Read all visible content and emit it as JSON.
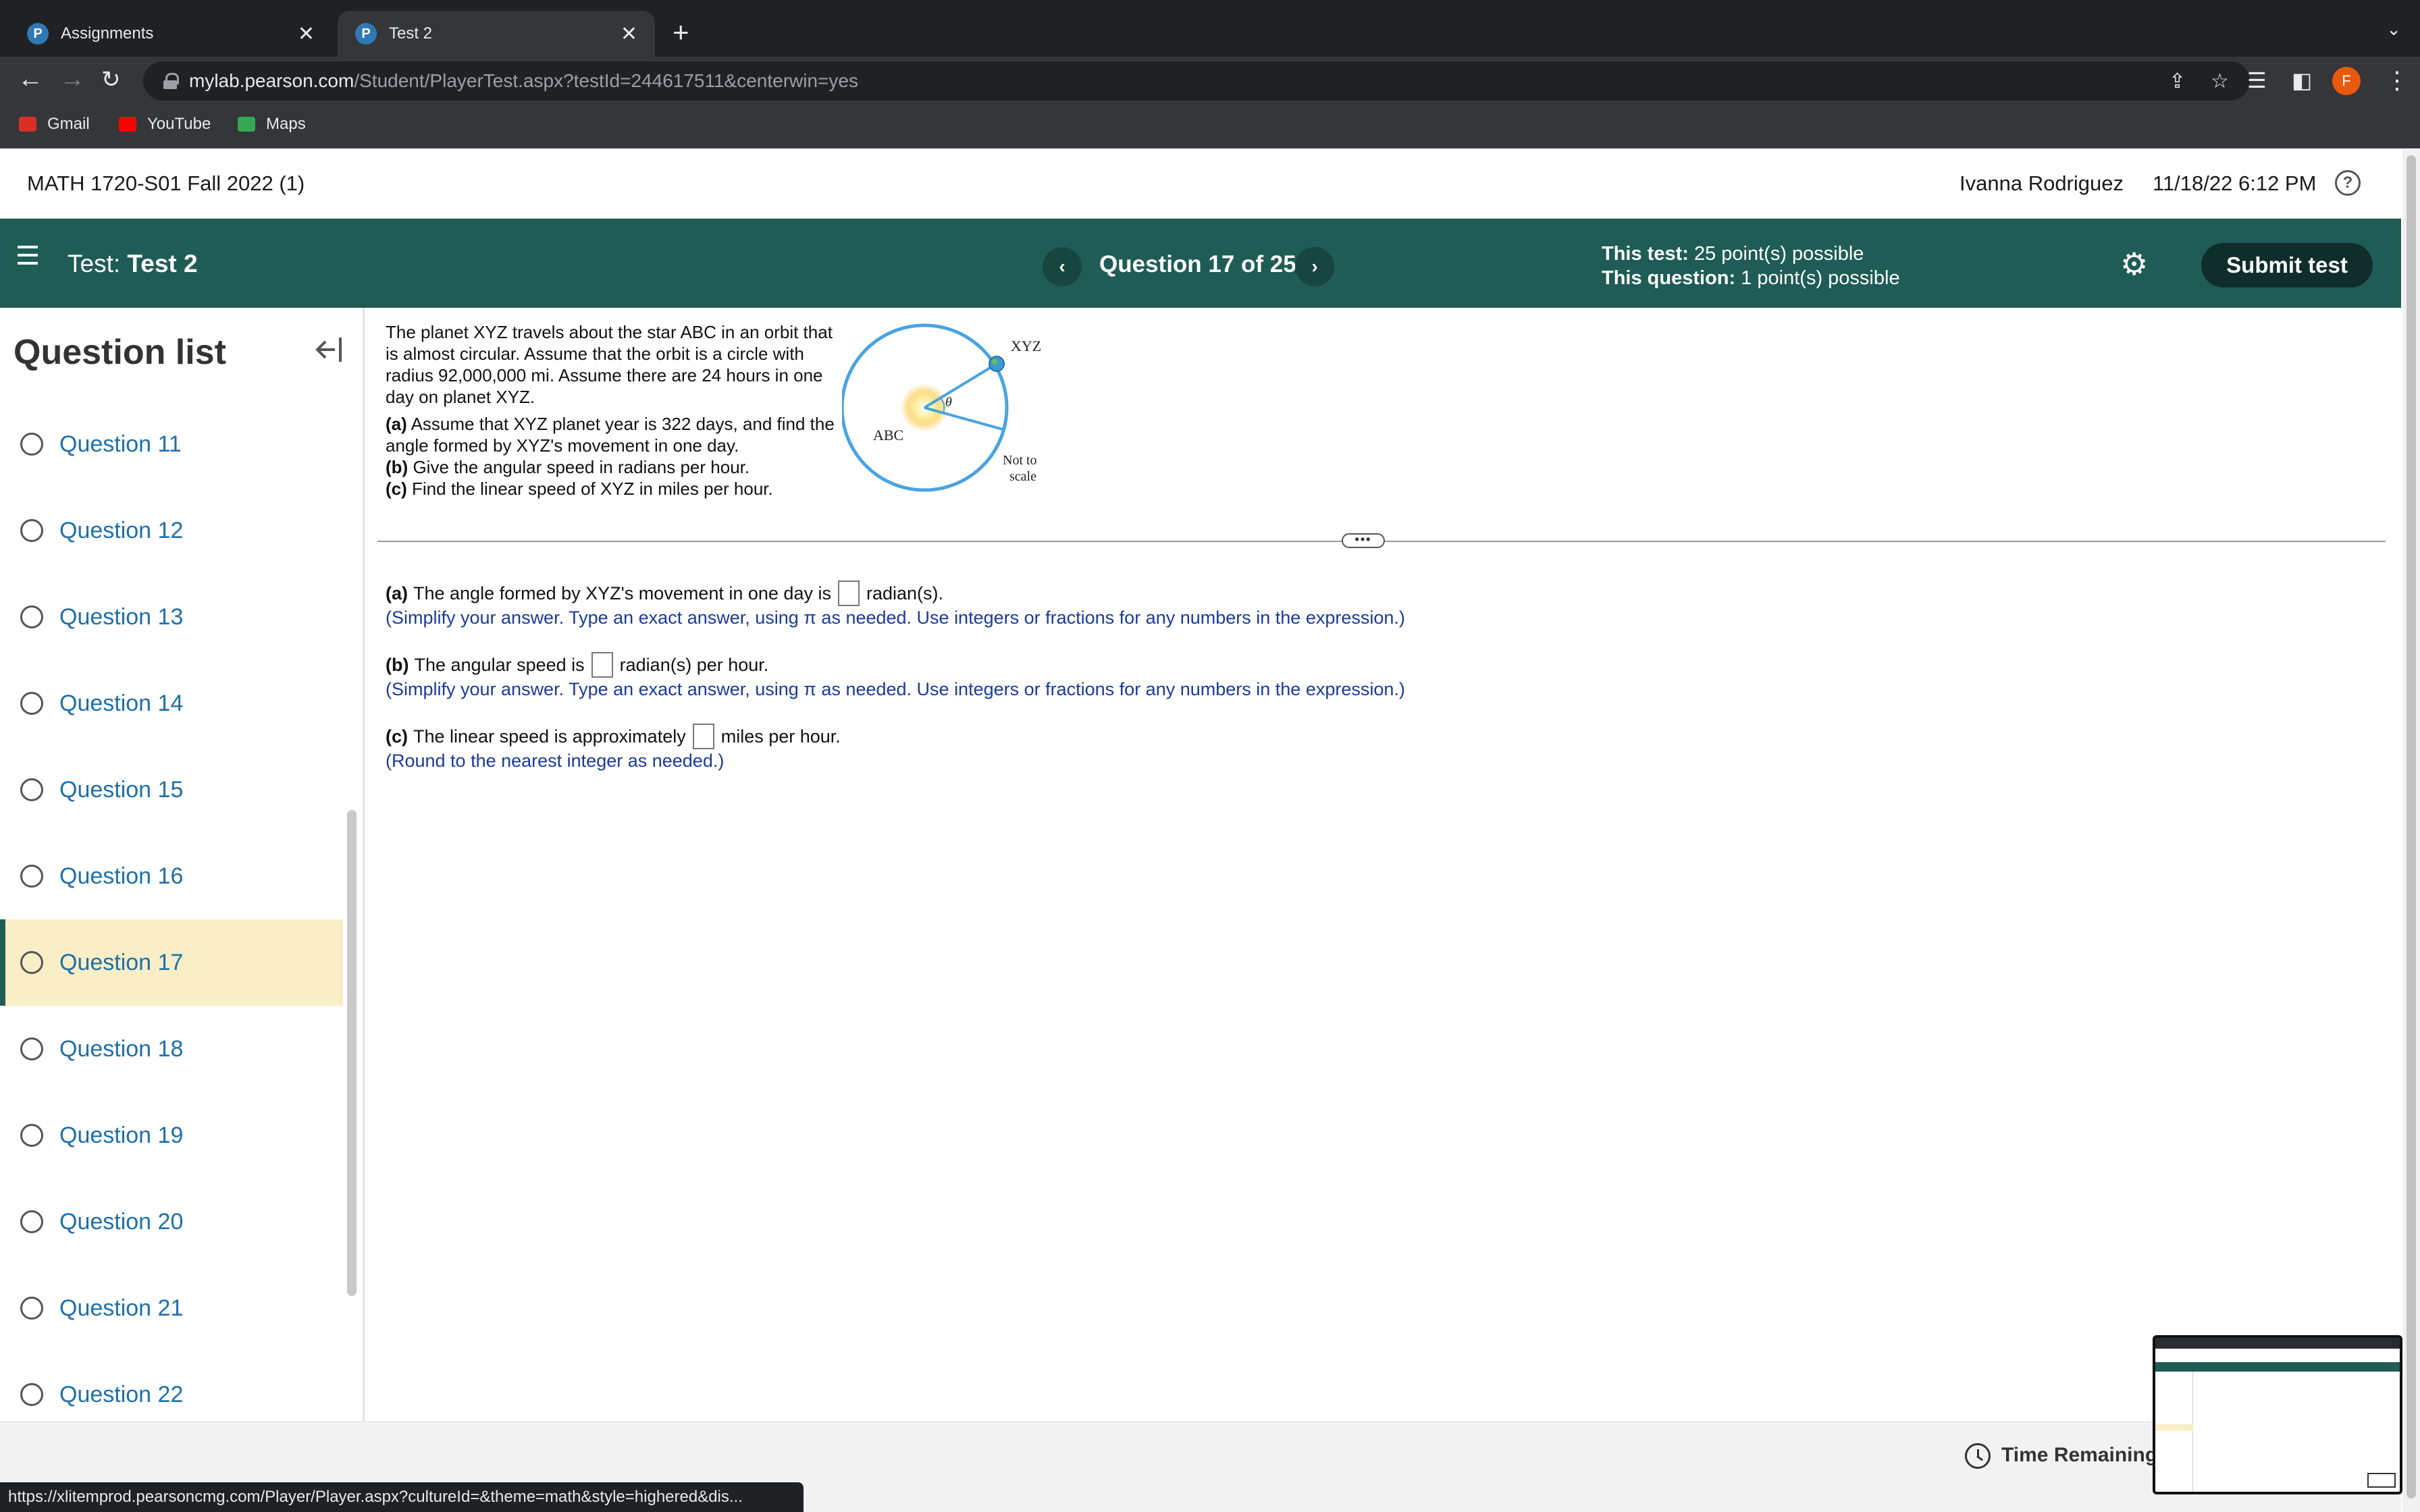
{
  "browser": {
    "tabs": [
      {
        "title": "Assignments",
        "favicon": "P",
        "active": false
      },
      {
        "title": "Test 2",
        "favicon": "P",
        "active": true
      }
    ],
    "url_host": "mylab.pearson.com",
    "url_path": "/Student/PlayerTest.aspx?testId=244617511&centerwin=yes",
    "profile_initial": "F",
    "bookmarks": [
      {
        "label": "Gmail",
        "icon": "gmail-icon",
        "color": "#d93025"
      },
      {
        "label": "YouTube",
        "icon": "youtube-icon",
        "color": "#ff0000"
      },
      {
        "label": "Maps",
        "icon": "maps-icon",
        "color": "#34a853"
      }
    ],
    "status_url": "https://xlitemprod.pearsoncmg.com/Player/Player.aspx?cultureId=&theme=math&style=highered&dis..."
  },
  "header": {
    "course_title": "MATH 1720-S01 Fall 2022 (1)",
    "user_name": "Ivanna Rodriguez",
    "datetime": "11/18/22 6:12 PM"
  },
  "test_bar": {
    "test_prefix": "Test:",
    "test_name": "Test 2",
    "question_counter": "Question 17 of 25",
    "this_test_label": "This test:",
    "this_test_value": "25 point(s) possible",
    "this_question_label": "This question:",
    "this_question_value": "1 point(s) possible",
    "submit_label": "Submit test",
    "accent_color": "#1f5c55"
  },
  "sidebar": {
    "title": "Question list",
    "items": [
      {
        "label": "Question 11"
      },
      {
        "label": "Question 12"
      },
      {
        "label": "Question 13"
      },
      {
        "label": "Question 14"
      },
      {
        "label": "Question 15"
      },
      {
        "label": "Question 16"
      },
      {
        "label": "Question 17"
      },
      {
        "label": "Question 18"
      },
      {
        "label": "Question 19"
      },
      {
        "label": "Question 20"
      },
      {
        "label": "Question 21"
      },
      {
        "label": "Question 22"
      }
    ],
    "current_item": 6
  },
  "problem": {
    "intro": "The planet XYZ travels about the star ABC in an orbit that is almost circular. Assume that the orbit is a circle with radius 92,000,000 mi. Assume there are 24 hours in one day on planet XYZ.",
    "part_a_tag": "(a)",
    "part_a": "Assume that XYZ planet year is 322 days, and find the angle formed by XYZ's movement in one day.",
    "part_b_tag": "(b)",
    "part_b": "Give the angular speed in radians per hour.",
    "part_c_tag": "(c)",
    "part_c": "Find the linear speed of XYZ in miles per hour.",
    "figure": {
      "planet_label": "XYZ",
      "star_label": "ABC",
      "angle_label": "θ",
      "note_line1": "Not to",
      "note_line2": "scale"
    }
  },
  "answers": {
    "a": {
      "tag": "(a)",
      "before": "The angle formed by XYZ's movement in one day is",
      "after": "radian(s).",
      "value": "",
      "hint": "(Simplify your answer. Type an exact answer, using π as needed. Use integers or fractions for any numbers in the expression.)"
    },
    "b": {
      "tag": "(b)",
      "before": "The angular speed is",
      "after": "radian(s) per hour.",
      "value": "",
      "hint": "(Simplify your answer. Type an exact answer, using π as needed. Use integers or fractions for any numbers in the expression.)"
    },
    "c": {
      "tag": "(c)",
      "before": "The linear speed is approximately",
      "after": "miles per hour.",
      "value": "",
      "hint": "(Round to the nearest integer as needed.)"
    }
  },
  "footer": {
    "time_label": "Time Remaining:"
  }
}
